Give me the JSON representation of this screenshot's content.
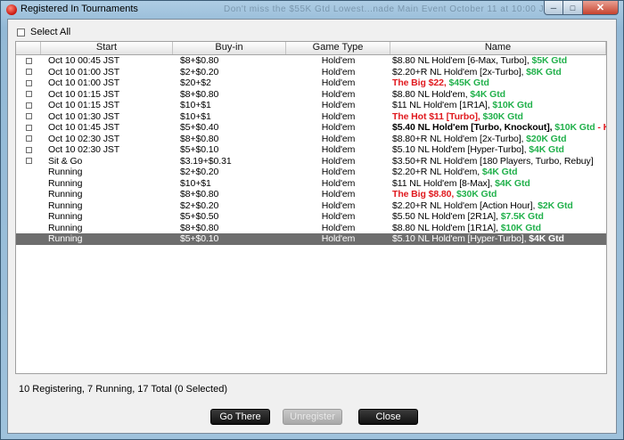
{
  "window": {
    "title": "Registered In Tournaments",
    "background_text": "Don't miss the $55K Gtd Lowest...nade Main Event October 11 at 10:00 JST"
  },
  "select_all_label": "Select All",
  "columns": [
    "",
    "Start",
    "Buy-in",
    "Game Type",
    "Name"
  ],
  "rows": [
    {
      "checkbox": true,
      "start": "Oct 10  00:45 JST",
      "buyin": "$8+$0.80",
      "game": "Hold'em",
      "name": [
        {
          "t": "$8.80 NL Hold'em [6-Max, Turbo], ",
          "s": "n"
        },
        {
          "t": "$5K Gtd",
          "s": "g"
        }
      ]
    },
    {
      "checkbox": true,
      "start": "Oct 10  01:00 JST",
      "buyin": "$2+$0.20",
      "game": "Hold'em",
      "name": [
        {
          "t": "$2.20+R NL Hold'em [2x-Turbo], ",
          "s": "n"
        },
        {
          "t": "$8K Gtd",
          "s": "g"
        }
      ]
    },
    {
      "checkbox": true,
      "start": "Oct 10  01:00 JST",
      "buyin": "$20+$2",
      "game": "Hold'em",
      "name": [
        {
          "t": "The Big $22, ",
          "s": "r"
        },
        {
          "t": "$45K Gtd",
          "s": "g"
        }
      ]
    },
    {
      "checkbox": true,
      "start": "Oct 10  01:15 JST",
      "buyin": "$8+$0.80",
      "game": "Hold'em",
      "name": [
        {
          "t": "$8.80 NL Hold'em, ",
          "s": "n"
        },
        {
          "t": "$4K Gtd",
          "s": "g"
        }
      ]
    },
    {
      "checkbox": true,
      "start": "Oct 10  01:15 JST",
      "buyin": "$10+$1",
      "game": "Hold'em",
      "name": [
        {
          "t": "$11 NL Hold'em [1R1A], ",
          "s": "n"
        },
        {
          "t": "$10K Gtd",
          "s": "g"
        }
      ]
    },
    {
      "checkbox": true,
      "start": "Oct 10  01:30 JST",
      "buyin": "$10+$1",
      "game": "Hold'em",
      "name": [
        {
          "t": "The Hot $11 [Turbo], ",
          "s": "r"
        },
        {
          "t": "$30K Gtd",
          "s": "g"
        }
      ]
    },
    {
      "checkbox": true,
      "start": "Oct 10  01:45 JST",
      "buyin": "$5+$0.40",
      "game": "Hold'em",
      "name": [
        {
          "t": "$5.40 NL Hold'em [Turbo, Knockout], ",
          "s": "b"
        },
        {
          "t": "$10K Gtd",
          "s": "g"
        },
        {
          "t": " - Kno...",
          "s": "r"
        }
      ]
    },
    {
      "checkbox": true,
      "start": "Oct 10  02:30 JST",
      "buyin": "$8+$0.80",
      "game": "Hold'em",
      "name": [
        {
          "t": "$8.80+R NL Hold'em [2x-Turbo], ",
          "s": "n"
        },
        {
          "t": "$20K Gtd",
          "s": "g"
        }
      ]
    },
    {
      "checkbox": true,
      "start": "Oct 10  02:30 JST",
      "buyin": "$5+$0.10",
      "game": "Hold'em",
      "name": [
        {
          "t": "$5.10 NL Hold'em [Hyper-Turbo], ",
          "s": "n"
        },
        {
          "t": "$4K Gtd",
          "s": "g"
        }
      ]
    },
    {
      "checkbox": true,
      "start": "Sit & Go",
      "buyin": "$3.19+$0.31",
      "game": "Hold'em",
      "name": [
        {
          "t": "$3.50+R NL Hold'em [180 Players, Turbo, Rebuy]",
          "s": "n"
        }
      ]
    },
    {
      "checkbox": false,
      "start": "Running",
      "buyin": "$2+$0.20",
      "game": "Hold'em",
      "name": [
        {
          "t": "$2.20+R NL Hold'em, ",
          "s": "n"
        },
        {
          "t": "$4K Gtd",
          "s": "g"
        }
      ]
    },
    {
      "checkbox": false,
      "start": "Running",
      "buyin": "$10+$1",
      "game": "Hold'em",
      "name": [
        {
          "t": "$11 NL Hold'em [8-Max], ",
          "s": "n"
        },
        {
          "t": "$4K Gtd",
          "s": "g"
        }
      ]
    },
    {
      "checkbox": false,
      "start": "Running",
      "buyin": "$8+$0.80",
      "game": "Hold'em",
      "name": [
        {
          "t": "The Big $8.80, ",
          "s": "r"
        },
        {
          "t": "$30K Gtd",
          "s": "g"
        }
      ]
    },
    {
      "checkbox": false,
      "start": "Running",
      "buyin": "$2+$0.20",
      "game": "Hold'em",
      "name": [
        {
          "t": "$2.20+R NL Hold'em [Action Hour], ",
          "s": "n"
        },
        {
          "t": "$2K Gtd",
          "s": "g"
        }
      ]
    },
    {
      "checkbox": false,
      "start": "Running",
      "buyin": "$5+$0.50",
      "game": "Hold'em",
      "name": [
        {
          "t": "$5.50 NL Hold'em [2R1A], ",
          "s": "n"
        },
        {
          "t": "$7.5K Gtd",
          "s": "g"
        }
      ]
    },
    {
      "checkbox": false,
      "start": "Running",
      "buyin": "$8+$0.80",
      "game": "Hold'em",
      "name": [
        {
          "t": "$8.80 NL Hold'em [1R1A], ",
          "s": "n"
        },
        {
          "t": "$10K Gtd",
          "s": "g"
        }
      ]
    },
    {
      "checkbox": false,
      "selected": true,
      "start": "Running",
      "buyin": "$5+$0.10",
      "game": "Hold'em",
      "name": [
        {
          "t": "$5.10 NL Hold'em [Hyper-Turbo], ",
          "s": "n"
        },
        {
          "t": "$4K Gtd",
          "s": "g"
        }
      ]
    }
  ],
  "status": "10 Registering, 7 Running, 17 Total (0 Selected)",
  "buttons": {
    "go_there": "Go There",
    "unregister": "Unregister",
    "close": "Close"
  },
  "colors": {
    "guaranteed": "#22b14c",
    "highlight": "#e0191e",
    "selected_row": "#6e6e6e"
  }
}
